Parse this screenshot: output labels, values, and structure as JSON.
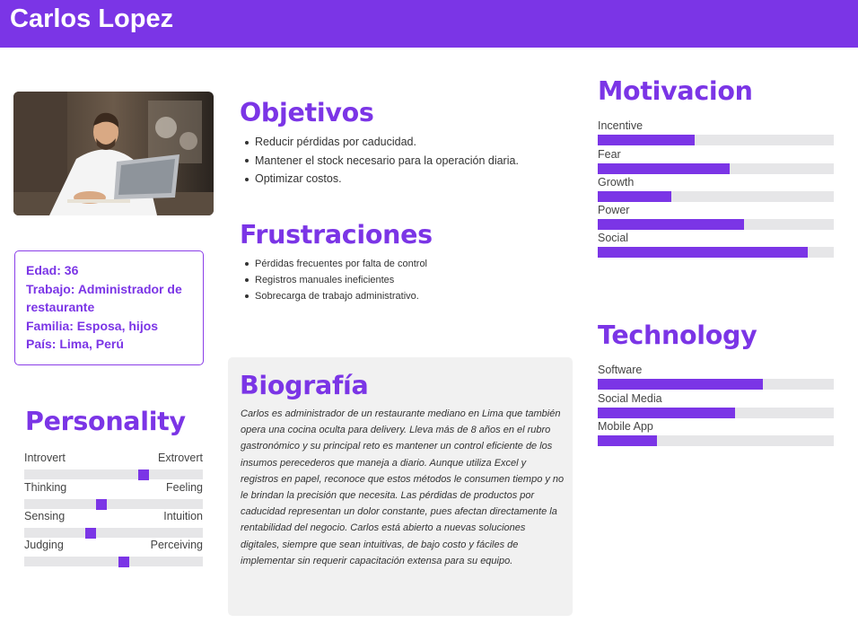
{
  "persona": {
    "name": "Carlos Lopez"
  },
  "colors": {
    "accent": "#7b35e6",
    "track": "#e6e6e8",
    "bio_bg": "#f1f1f1"
  },
  "info": {
    "age": "Edad: 36",
    "job_1": "Trabajo: Administrador de",
    "job_2": "restaurante",
    "family": "Familia: Esposa, hijos",
    "country": "País: Lima, Perú"
  },
  "objectives": {
    "title": "Objetivos",
    "items": [
      "Reducir pérdidas por caducidad.",
      "Mantener el stock necesario para la operación diaria.",
      "Optimizar costos."
    ]
  },
  "frustrations": {
    "title": "Frustraciones",
    "items": [
      "Pérdidas frecuentes por falta de control",
      "Registros manuales ineficientes",
      "Sobrecarga de trabajo administrativo."
    ]
  },
  "biography": {
    "title": "Biografía",
    "text": "Carlos es administrador de un restaurante mediano en Lima que también opera una cocina oculta para delivery. Lleva más de 8 años en el rubro gastronómico y su principal reto es mantener un control eficiente de los insumos perecederos que maneja a diario. Aunque utiliza Excel y registros en papel, reconoce que estos métodos le consumen tiempo y no le brindan la precisión que necesita. Las pérdidas de productos por caducidad representan un dolor constante, pues afectan directamente la rentabilidad del negocio. Carlos está abierto a nuevas soluciones digitales, siempre que sean intuitivas, de bajo costo y fáciles de implementar sin requerir capacitación extensa para su equipo."
  },
  "personality": {
    "title": "Personality",
    "scales": [
      {
        "left": "Introvert",
        "right": "Extrovert",
        "value": 0.67
      },
      {
        "left": "Thinking",
        "right": "Feeling",
        "value": 0.43
      },
      {
        "left": "Sensing",
        "right": "Intuition",
        "value": 0.37
      },
      {
        "left": "Judging",
        "right": "Perceiving",
        "value": 0.56
      }
    ]
  },
  "motivation": {
    "title": "Motivacion",
    "items": [
      {
        "label": "Incentive",
        "value": 0.41
      },
      {
        "label": "Fear",
        "value": 0.56
      },
      {
        "label": "Growth",
        "value": 0.31
      },
      {
        "label": "Power",
        "value": 0.62
      },
      {
        "label": "Social",
        "value": 0.89
      }
    ]
  },
  "technology": {
    "title": "Technology",
    "items": [
      {
        "label": "Software",
        "value": 0.7
      },
      {
        "label": "Social Media",
        "value": 0.58
      },
      {
        "label": "Mobile App",
        "value": 0.25
      }
    ]
  }
}
